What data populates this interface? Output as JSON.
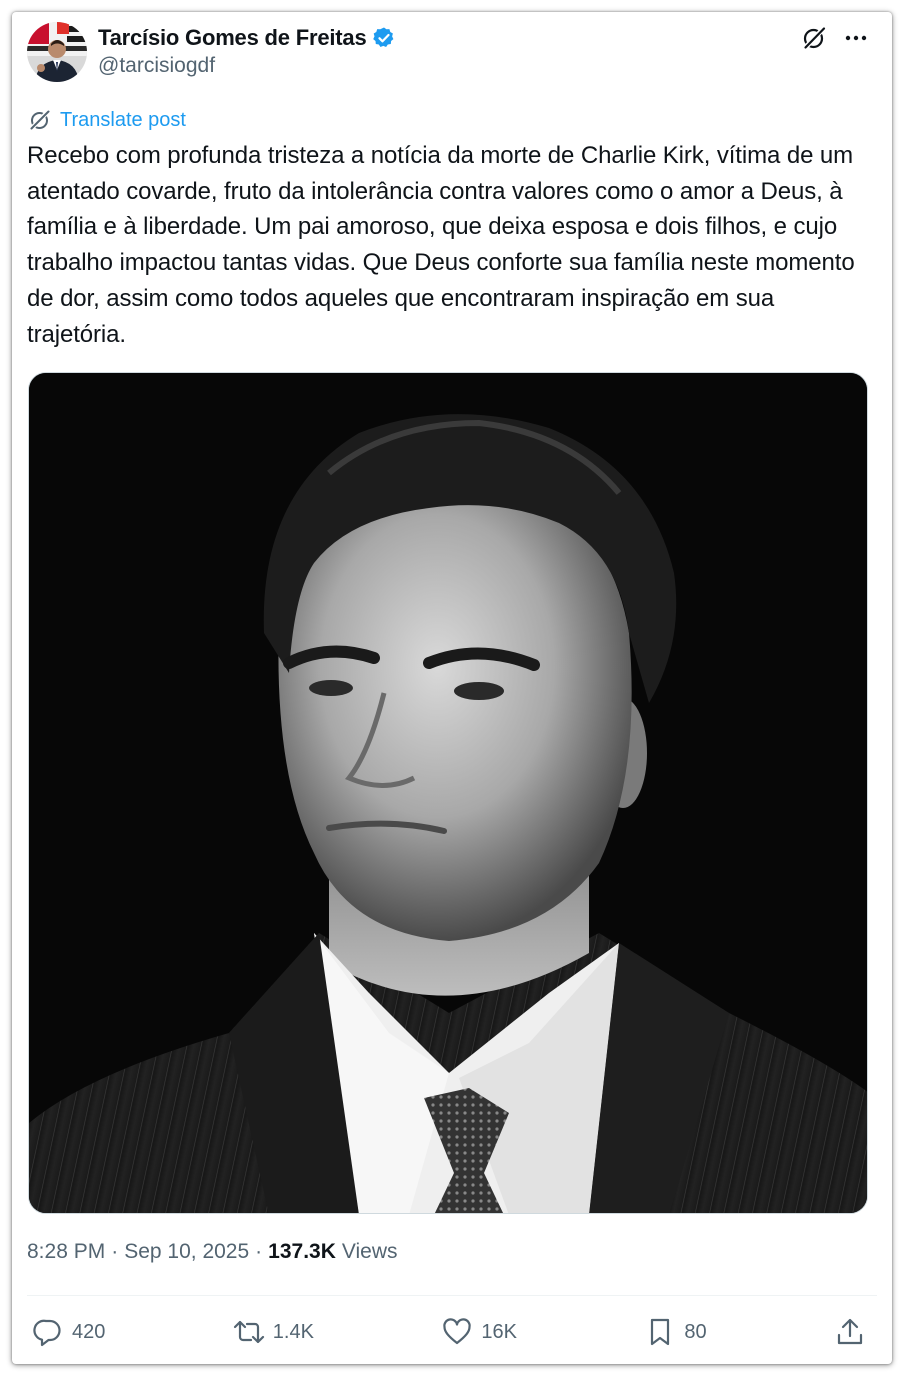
{
  "author": {
    "name": "Tarcísio Gomes de Freitas",
    "handle": "@tarcisiogdf",
    "verified_color": "#1d9bf0"
  },
  "header_icons": [
    "grok-icon",
    "more-icon"
  ],
  "translate": {
    "label": "Translate post"
  },
  "post": {
    "text": "Recebo com profunda tristeza a notícia da morte de Charlie Kirk, vítima de um atentado covarde, fruto da intolerância contra valores como o amor a Deus, à família e à liberdade. Um pai amoroso, que deixa esposa e dois filhos, e cujo trabalho impactou tantas vidas. Que Deus conforte sua família neste momento de dor, assim como todos aqueles que encontraram inspiração em sua trajetória."
  },
  "meta": {
    "time": "8:28 PM",
    "separator": "·",
    "date": "Sep 10, 2025",
    "views_count": "137.3K",
    "views_label": "Views"
  },
  "actions": {
    "replies": "420",
    "reposts": "1.4K",
    "likes": "16K",
    "bookmarks": "80"
  },
  "colors": {
    "text": "#0f1419",
    "secondary": "#536471",
    "link": "#1d9bf0"
  }
}
